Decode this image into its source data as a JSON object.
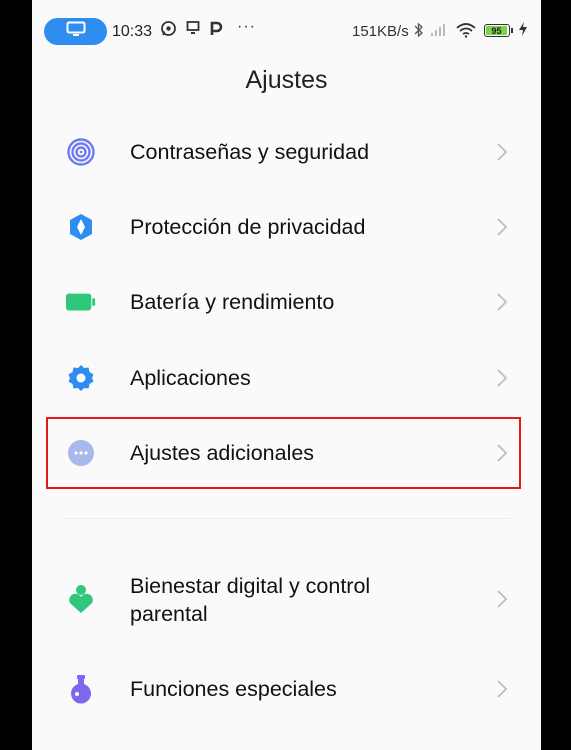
{
  "status_bar": {
    "time": "10:33",
    "network_speed": "151KB/s",
    "battery_level": "95",
    "icons": [
      "screen-icon",
      "whatsapp-icon",
      "cast-icon",
      "p-icon",
      "more-icon",
      "bluetooth-icon",
      "signal-icon",
      "wifi-icon",
      "battery-icon",
      "charging-icon"
    ],
    "more_glyph": "···"
  },
  "header": {
    "title": "Ajustes"
  },
  "settings": {
    "items": [
      {
        "label": "Contraseñas y seguridad",
        "icon": "fingerprint-icon",
        "color": "#6f7af0"
      },
      {
        "label": "Protección de privacidad",
        "icon": "privacy-shield-icon",
        "color": "#2f8cf0"
      },
      {
        "label": "Batería y rendimiento",
        "icon": "battery-icon",
        "color": "#2ec77c"
      },
      {
        "label": "Aplicaciones",
        "icon": "gear-icon",
        "color": "#2f8cf0"
      },
      {
        "label": "Ajustes adicionales",
        "icon": "more-dots-icon",
        "color": "#9fb0e8"
      },
      {
        "label": "Bienestar digital y control",
        "label_line2": "parental",
        "icon": "wellbeing-icon",
        "color": "#2ec77c"
      },
      {
        "label": "Funciones especiales",
        "icon": "flask-icon",
        "color": "#7b68ee"
      }
    ]
  },
  "highlight_color": "#e21a1a"
}
